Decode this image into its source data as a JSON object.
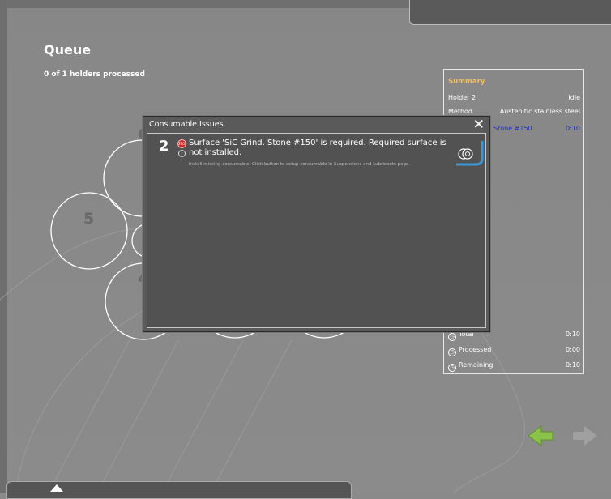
{
  "page": {
    "title": "Queue",
    "subtitle": "0 of 1 holders processed"
  },
  "holders": [
    {
      "number": "6"
    },
    {
      "number": "5"
    },
    {
      "number": "4"
    }
  ],
  "summary": {
    "title": "Summary",
    "holder_label": "Holder 2",
    "holder_status": "Idle",
    "method_label": "Method",
    "method_value": "Austenitic stainless steel",
    "step_name": "Stone #150",
    "step_time": "0:10",
    "total_label": "Total",
    "total_value": "0:10",
    "processed_label": "Processed",
    "processed_value": "0:00",
    "remaining_label": "Remaining",
    "remaining_value": "0:10"
  },
  "dialog": {
    "title": "Consumable Issues",
    "close_glyph": "✕",
    "issues": [
      {
        "number": "2",
        "stop_label": "STOP",
        "message": "Surface 'SiC Grind. Stone #150' is required. Required surface is not installed.",
        "hint": "Install missing consumable. Click button to setup consumable in Suspensions and Lubricants page."
      }
    ]
  },
  "icons": {
    "back": "arrow-left-icon",
    "forward": "arrow-right-icon",
    "expand": "arrow-up-icon"
  },
  "colors": {
    "accent_green": "#8bc34a",
    "summary_title": "#f0c060",
    "blue_text": "#2030d0",
    "stop_red": "#d02828"
  }
}
